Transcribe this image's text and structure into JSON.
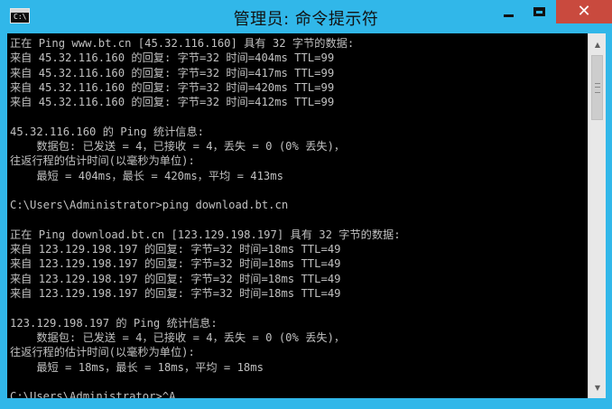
{
  "window": {
    "title": "管理员: 命令提示符",
    "icon": "console-icon",
    "icon_text": "C:\\",
    "buttons": {
      "minimize": "minimize-icon",
      "maximize": "maximize-icon",
      "close": "✕"
    },
    "colors": {
      "titlebar": "#31b7e9",
      "close": "#c94a3e",
      "console_bg": "#000000",
      "console_fg": "#c0c0c0"
    }
  },
  "console": {
    "lines": [
      "正在 Ping www.bt.cn [45.32.116.160] 具有 32 字节的数据:",
      "来自 45.32.116.160 的回复: 字节=32 时间=404ms TTL=99",
      "来自 45.32.116.160 的回复: 字节=32 时间=417ms TTL=99",
      "来自 45.32.116.160 的回复: 字节=32 时间=420ms TTL=99",
      "来自 45.32.116.160 的回复: 字节=32 时间=412ms TTL=99",
      "",
      "45.32.116.160 的 Ping 统计信息:",
      "    数据包: 已发送 = 4，已接收 = 4，丢失 = 0 (0% 丢失)，",
      "往返行程的估计时间(以毫秒为单位):",
      "    最短 = 404ms，最长 = 420ms，平均 = 413ms",
      "",
      "C:\\Users\\Administrator>ping download.bt.cn",
      "",
      "正在 Ping download.bt.cn [123.129.198.197] 具有 32 字节的数据:",
      "来自 123.129.198.197 的回复: 字节=32 时间=18ms TTL=49",
      "来自 123.129.198.197 的回复: 字节=32 时间=18ms TTL=49",
      "来自 123.129.198.197 的回复: 字节=32 时间=18ms TTL=49",
      "来自 123.129.198.197 的回复: 字节=32 时间=18ms TTL=49",
      "",
      "123.129.198.197 的 Ping 统计信息:",
      "    数据包: 已发送 = 4，已接收 = 4，丢失 = 0 (0% 丢失)，",
      "往返行程的估计时间(以毫秒为单位):",
      "    最短 = 18ms，最长 = 18ms，平均 = 18ms",
      "",
      "C:\\Users\\Administrator>^A"
    ]
  },
  "scrollbar": {
    "up": "▲",
    "down": "▼"
  }
}
